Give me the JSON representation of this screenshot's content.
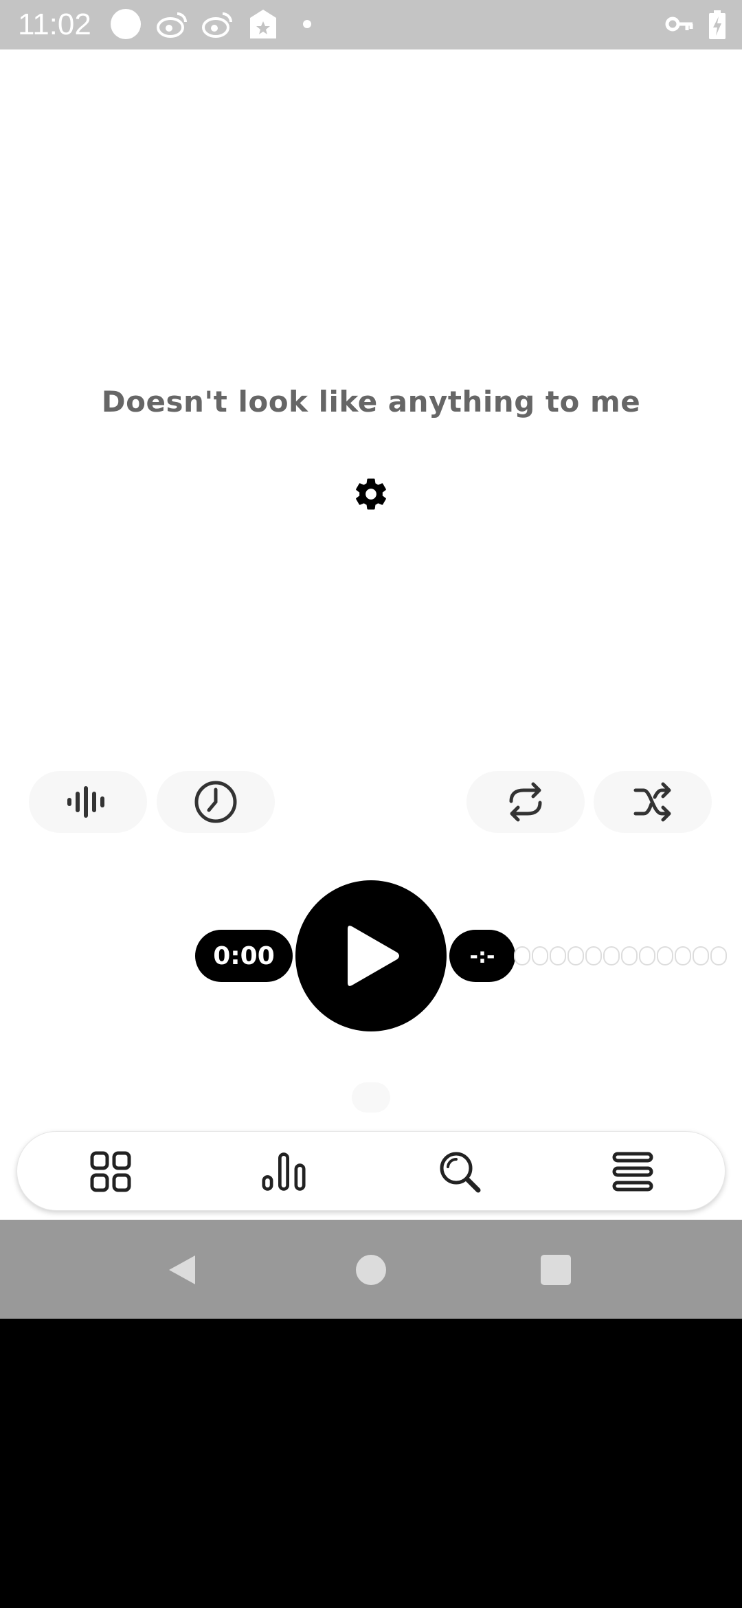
{
  "status_bar": {
    "time": "11:02",
    "icons": [
      "circle-notification-icon",
      "weibo-icon",
      "weibo-icon",
      "store-tag-icon",
      "dot-icon",
      "vpn-key-icon",
      "battery-charging-icon"
    ]
  },
  "main": {
    "empty_message": "Doesn't look like anything to me",
    "settings_icon": "gear-icon"
  },
  "controls": {
    "left": [
      "equalizer-icon",
      "sleep-timer-clock-icon"
    ],
    "right": [
      "repeat-icon",
      "shuffle-icon"
    ]
  },
  "player": {
    "elapsed": "0:00",
    "remaining": "-:-",
    "play_icon": "play-icon"
  },
  "bottom_nav": {
    "items": [
      "grid-icon",
      "stats-bars-icon",
      "search-icon",
      "menu-lines-icon"
    ]
  },
  "system_nav": {
    "items": [
      "back-icon",
      "home-icon",
      "recents-icon"
    ]
  },
  "colors": {
    "accent": "#000000",
    "message_text": "#666666",
    "status_bar": "#c4c4c4",
    "system_nav": "#999999"
  }
}
